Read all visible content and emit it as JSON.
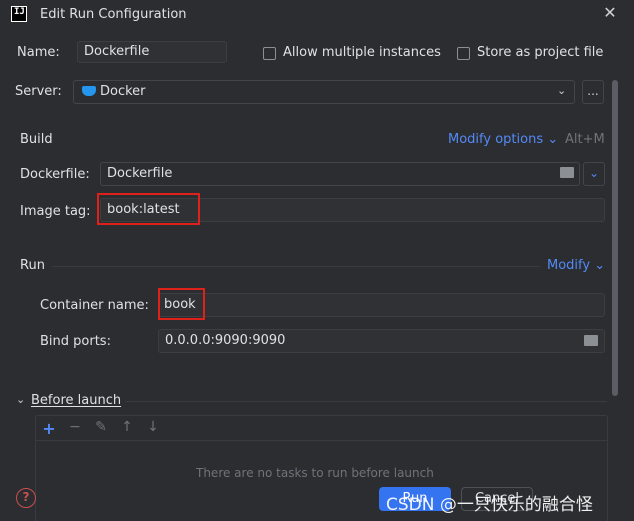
{
  "window": {
    "title": "Edit Run Configuration",
    "app_icon": "IJ"
  },
  "name_row": {
    "label": "Name:",
    "value": "Dockerfile",
    "allow_multiple_label": "Allow multiple instances",
    "store_label": "Store as project file"
  },
  "server_row": {
    "label": "Server:",
    "value": "Docker",
    "more": "..."
  },
  "build": {
    "title": "Build",
    "modify_options": "Modify options",
    "chevron": "⌄",
    "shortcut": "Alt+M",
    "dockerfile_label": "Dockerfile:",
    "dockerfile_value": "Dockerfile",
    "image_tag_label": "Image tag:",
    "image_tag_value": "book:latest"
  },
  "run": {
    "title": "Run",
    "modify": "Modify",
    "chevron": "⌄",
    "container_name_label": "Container name:",
    "container_name_value": "book",
    "bind_ports_label": "Bind ports:",
    "bind_ports_value": "0.0.0.0:9090:9090"
  },
  "before_launch": {
    "title": "Before launch",
    "hidden_hint": "There are no tasks to run before launch"
  },
  "footer": {
    "help": "?",
    "run_label": "Run",
    "cancel_label": "Cancel"
  },
  "watermark": "CSDN @一只快乐的融合怪",
  "colors": {
    "accent": "#548af7",
    "primary_button": "#3574f0",
    "highlight_box": "#e0201b",
    "background": "#2b2d30"
  }
}
